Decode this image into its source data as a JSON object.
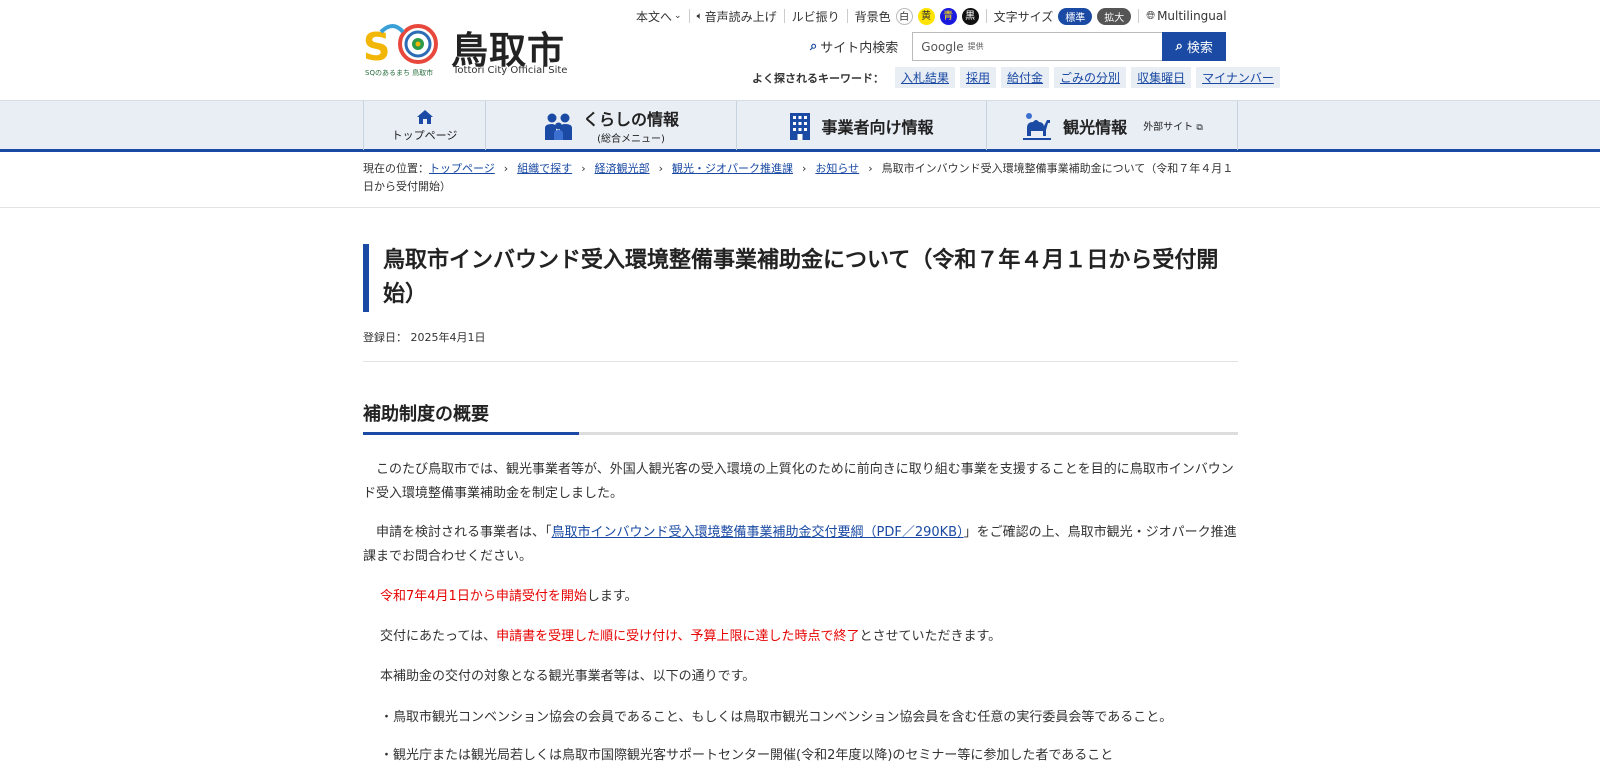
{
  "header": {
    "logo_sub": "SQのあるまち 鳥取市",
    "logo_title": "鳥取市",
    "logo_en": "Tottori City Official Site",
    "util": {
      "skip": "本文へ",
      "voice": "音声読み上げ",
      "ruby": "ルビ振り",
      "bg_label": "背景色",
      "bg_white": "白",
      "bg_yellow": "黄",
      "bg_blue": "青",
      "bg_black": "黒",
      "fs_label": "文字サイズ",
      "fs_normal": "標準",
      "fs_large": "拡大",
      "multilingual": "Multilingual"
    },
    "search": {
      "label": "サイト内検索",
      "placeholder": "Google",
      "provider": "提供",
      "button": "検索"
    },
    "keywords": {
      "label": "よく探されるキーワード：",
      "items": [
        "入札結果",
        "採用",
        "給付金",
        "ごみの分別",
        "収集曜日",
        "マイナンバー"
      ]
    }
  },
  "gnav": {
    "top": "トップページ",
    "kurashi": "くらしの情報",
    "kurashi_sub": "(総合メニュー)",
    "jigyo": "事業者向け情報",
    "kanko": "観光情報",
    "kanko_ext": "外部サイト"
  },
  "breadcrumb": {
    "label": "現在の位置：",
    "items": [
      "トップページ",
      "組織で探す",
      "経済観光部",
      "観光・ジオパーク推進課",
      "お知らせ"
    ],
    "current": "鳥取市インバウンド受入環境整備事業補助金について（令和７年４月１日から受付開始）"
  },
  "main": {
    "title": "鳥取市インバウンド受入環境整備事業補助金について（令和７年４月１日から受付開始）",
    "date_label": "登録日：",
    "date": "2025年4月1日",
    "h2": "補助制度の概要",
    "p1": "　このたび鳥取市では、観光事業者等が、外国人観光客の受入環境の上質化のために前向きに取り組む事業を支援することを目的に鳥取市インバウンド受入環境整備事業補助金を制定しました。",
    "p2_pre": "　申請を検討される事業者は、「",
    "p2_link": "鳥取市インバウンド受入環境整備事業補助金交付要綱（PDF／290KB）",
    "p2_post": "」をご確認の上、鳥取市観光・ジオパーク推進課までお問合わせください。",
    "p3_red": "令和7年4月1日から申請受付を開始",
    "p3_post": "します。",
    "p4_pre": "交付にあたっては、",
    "p4_red": "申請書を受理した順に受け付け、予算上限に達した時点で終了",
    "p4_post": "とさせていただきます。",
    "p5": "本補助金の交付の対象となる観光事業者等は、以下の通りです。",
    "p6": "・鳥取市観光コンベンション協会の会員であること、もしくは鳥取市観光コンベンション協会員を含む任意の実行委員会等であること。",
    "p7": "・観光庁または観光局若しくは鳥取市国際観光客サポートセンター開催(令和2年度以降)のセミナー等に参加した者であること"
  },
  "colors": {
    "accent": "#1a4aa3",
    "nav_bg": "#e9eef5",
    "red": "#e60000"
  }
}
